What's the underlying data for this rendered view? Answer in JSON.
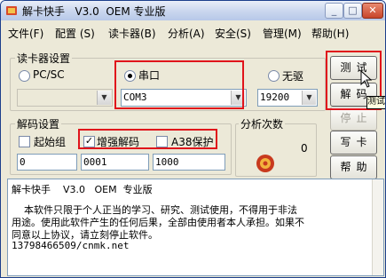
{
  "window": {
    "title": "解卡快手   V3.0  OEM 专业版",
    "min_icon": "minimize-icon",
    "max_icon": "maximize-icon",
    "close_icon": "close-icon"
  },
  "menubar": [
    "文件(F)",
    "配置 (S)",
    "读卡器(B)",
    "分析(A)",
    "安全(S)",
    "管理(M)",
    "帮助(H)"
  ],
  "reader_group": {
    "title": "读卡器设置",
    "pcsc_label": "PC/SC",
    "serial_label": "串口",
    "no_drive_label": "无驱",
    "selected": "串口",
    "pcsc_value": "",
    "port_value": "COM3",
    "baud_value": "19200"
  },
  "decode_group": {
    "title": "解码设置",
    "start_group_label": "起始组",
    "start_group_checked": false,
    "enhanced_label": "增强解码",
    "enhanced_checked": true,
    "a38_label": "A38保护",
    "a38_checked": false,
    "field1": "0",
    "field2": "0001",
    "field3": "1000"
  },
  "analysis_group": {
    "title": "分析次数",
    "count": "0"
  },
  "buttons": {
    "test": "测试",
    "decode": "解码",
    "stop": "停止",
    "write": "写卡",
    "help": "帮助"
  },
  "tooltip": "测试",
  "textpane": {
    "line1": "解卡快手    V3.0   OEM  专业版",
    "line2": "    本软件只限于个人正当的学习、研究、测试使用，不得用于非法",
    "line3": "用途。使用此软件产生的任何后果，全部由使用者本人承担。如果不",
    "line4": "同意以上协议，请立刻停止软件。",
    "line5": "13798466509/cnmk.net"
  },
  "colors": {
    "highlight": "#e0141b",
    "window_bg": "#ece9d8",
    "title_bg": "#c9d6ee"
  }
}
